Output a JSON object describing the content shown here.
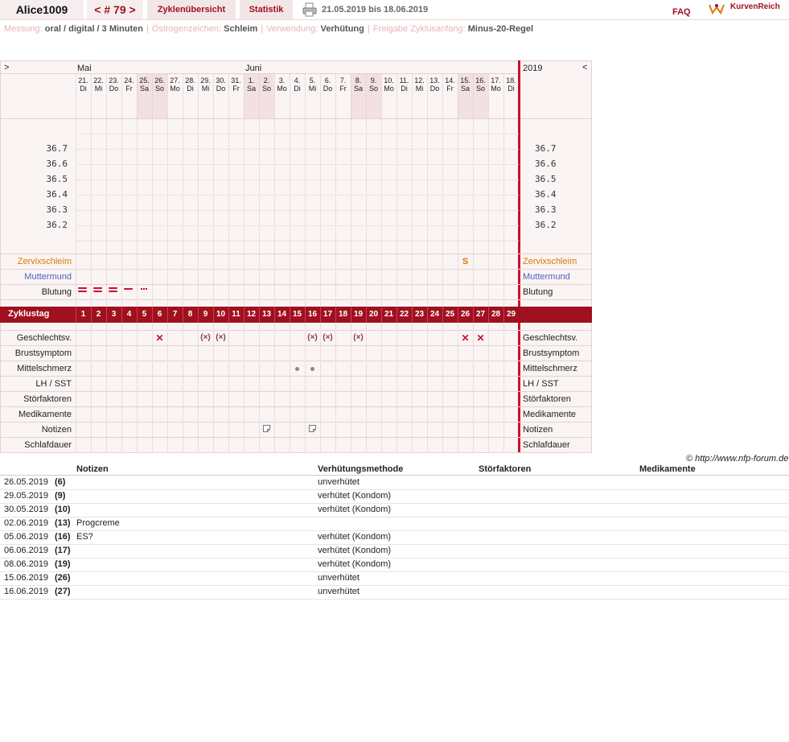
{
  "header": {
    "user": "Alice1009",
    "cycle": "< # 79 >",
    "overview_label": "Zyklenübersicht",
    "stats_label": "Statistik",
    "range": "21.05.2019 bis 18.06.2019",
    "faq_label": "FAQ",
    "logo_text": "KurvenReich"
  },
  "info": [
    {
      "key": "Messung:",
      "value": "oral / digital / 3 Minuten"
    },
    {
      "key": "Östrogenzeichen:",
      "value": "Schleim"
    },
    {
      "key": "Verwendung:",
      "value": "Verhütung"
    },
    {
      "key": "Freigabe Zyklusanfang:",
      "value": "Minus-20-Regel"
    }
  ],
  "chart": {
    "nav_prev": ">",
    "nav_next": "<",
    "year_label": "2019",
    "month_may": "Mai",
    "month_june": "Juni",
    "dates": [
      "21.",
      "22.",
      "23.",
      "24.",
      "25.",
      "26.",
      "27.",
      "28.",
      "29.",
      "30.",
      "31.",
      "1.",
      "2.",
      "3.",
      "4.",
      "5.",
      "6.",
      "7.",
      "8.",
      "9.",
      "10.",
      "11.",
      "12.",
      "13.",
      "14.",
      "15.",
      "16.",
      "17.",
      "18."
    ],
    "weekdays": [
      "Di",
      "Mi",
      "Do",
      "Fr",
      "Sa",
      "So",
      "Mo",
      "Di",
      "Mi",
      "Do",
      "Fr",
      "Sa",
      "So",
      "Mo",
      "Di",
      "Mi",
      "Do",
      "Fr",
      "Sa",
      "So",
      "Mo",
      "Di",
      "Mi",
      "Do",
      "Fr",
      "Sa",
      "So",
      "Mo",
      "Di"
    ],
    "temp_ticks": [
      "36.7",
      "36.6",
      "36.5",
      "36.4",
      "36.3",
      "36.2"
    ],
    "rows": {
      "zervix": "Zervixschleim",
      "muttermund": "Muttermund",
      "blutung": "Blutung",
      "zyklustag": "Zyklustag",
      "geschlecht": "Geschlechtsv.",
      "brust": "Brustsymptom",
      "mittel": "Mittelschmerz",
      "lh": "LH / SST",
      "stoer": "Störfaktoren",
      "medi": "Medikamente",
      "notizen": "Notizen",
      "schlaf": "Schlafdauer"
    },
    "cycle_days": [
      "1",
      "2",
      "3",
      "4",
      "5",
      "6",
      "7",
      "8",
      "9",
      "10",
      "11",
      "12",
      "13",
      "14",
      "15",
      "16",
      "17",
      "18",
      "19",
      "20",
      "21",
      "22",
      "23",
      "24",
      "25",
      "26",
      "27",
      "28",
      "29"
    ],
    "zervix_marks": [
      {
        "day": 26,
        "text": "S"
      }
    ],
    "blutung": [
      {
        "day": 1,
        "level": "heavy"
      },
      {
        "day": 2,
        "level": "heavy"
      },
      {
        "day": 3,
        "level": "heavy"
      },
      {
        "day": 4,
        "level": "medium"
      },
      {
        "day": 5,
        "level": "spotting"
      }
    ],
    "sex_marks": [
      {
        "day": 6,
        "protected": false
      },
      {
        "day": 9,
        "protected": true
      },
      {
        "day": 10,
        "protected": true
      },
      {
        "day": 16,
        "protected": true
      },
      {
        "day": 17,
        "protected": true
      },
      {
        "day": 19,
        "protected": true
      },
      {
        "day": 26,
        "protected": false
      },
      {
        "day": 27,
        "protected": false
      }
    ],
    "mittelschmerz_days": [
      15,
      16
    ],
    "notiz_days": [
      13,
      16
    ],
    "copyright": "© http://www.nfp-forum.de"
  },
  "colors": {
    "brand": "#a0101e",
    "zervix": "#e07800",
    "muttermund": "#5060c0",
    "weekend": "#f2e0e2"
  },
  "notes_table": {
    "headers": [
      "Notizen",
      "Verhütungsmethode",
      "Störfaktoren",
      "Medikamente"
    ],
    "rows": [
      {
        "date": "26.05.2019",
        "day": "(6)",
        "note": "",
        "method": "unverhütet"
      },
      {
        "date": "29.05.2019",
        "day": "(9)",
        "note": "",
        "method": "verhütet (Kondom)"
      },
      {
        "date": "30.05.2019",
        "day": "(10)",
        "note": "",
        "method": "verhütet (Kondom)"
      },
      {
        "date": "02.06.2019",
        "day": "(13)",
        "note": "Progcreme",
        "method": ""
      },
      {
        "date": "05.06.2019",
        "day": "(16)",
        "note": "ES?",
        "method": "verhütet (Kondom)"
      },
      {
        "date": "06.06.2019",
        "day": "(17)",
        "note": "",
        "method": "verhütet (Kondom)"
      },
      {
        "date": "08.06.2019",
        "day": "(19)",
        "note": "",
        "method": "verhütet (Kondom)"
      },
      {
        "date": "15.06.2019",
        "day": "(26)",
        "note": "",
        "method": "unverhütet"
      },
      {
        "date": "16.06.2019",
        "day": "(27)",
        "note": "",
        "method": "unverhütet"
      }
    ]
  }
}
